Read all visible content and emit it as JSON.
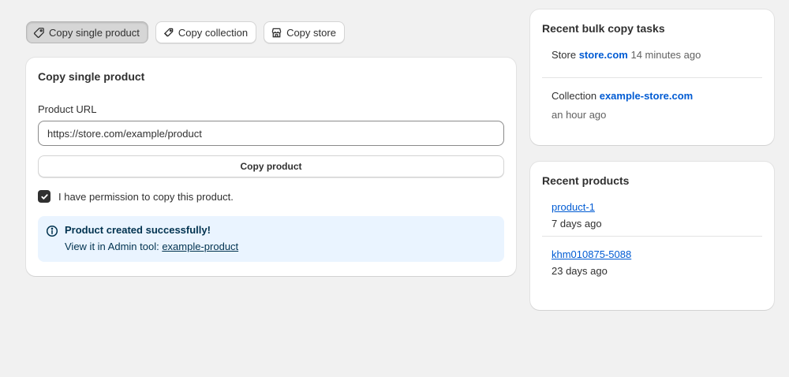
{
  "tabs": [
    {
      "label": "Copy single product",
      "icon": "tag-icon",
      "active": true
    },
    {
      "label": "Copy collection",
      "icon": "collection-tag-icon",
      "active": false
    },
    {
      "label": "Copy store",
      "icon": "store-icon",
      "active": false
    }
  ],
  "form": {
    "title": "Copy single product",
    "url_label": "Product URL",
    "url_value": "https://store.com/example/product",
    "submit_label": "Copy product",
    "permission_label": "I have permission to copy this product.",
    "permission_checked": true
  },
  "banner": {
    "title": "Product created successfully!",
    "text_prefix": "View it in Admin tool: ",
    "link_text": "example-product",
    "icon": "info-icon"
  },
  "tasks": {
    "title": "Recent bulk copy tasks",
    "items": [
      {
        "type": "Store",
        "link": "store.com",
        "time": "14 minutes ago"
      },
      {
        "type": "Collection",
        "link": "example-store.com",
        "time": "an hour ago"
      }
    ]
  },
  "products": {
    "title": "Recent products",
    "items": [
      {
        "name": "product-1",
        "age": "7 days ago"
      },
      {
        "name": "khm010875-5088",
        "age": "23 days ago"
      }
    ]
  },
  "colors": {
    "link": "#005bd3",
    "banner_bg": "#eaf4ff",
    "text": "#303030"
  }
}
